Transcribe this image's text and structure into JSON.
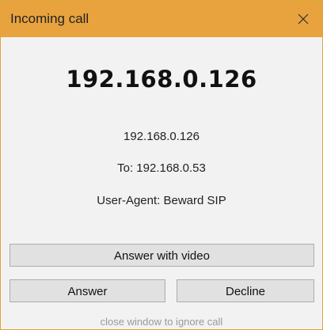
{
  "window": {
    "title": "Incoming call",
    "close_glyph": "close-icon"
  },
  "caller": {
    "display_name": "192.168.0.126",
    "address": "192.168.0.126",
    "to": "To: 192.168.0.53",
    "user_agent": "User-Agent: Beward SIP"
  },
  "buttons": {
    "answer_video": "Answer with video",
    "answer": "Answer",
    "decline": "Decline"
  },
  "hint": "close window to ignore call",
  "colors": {
    "titlebar": "#e8a33e",
    "background": "#f2f2f2",
    "button": "#e1e1e1"
  }
}
